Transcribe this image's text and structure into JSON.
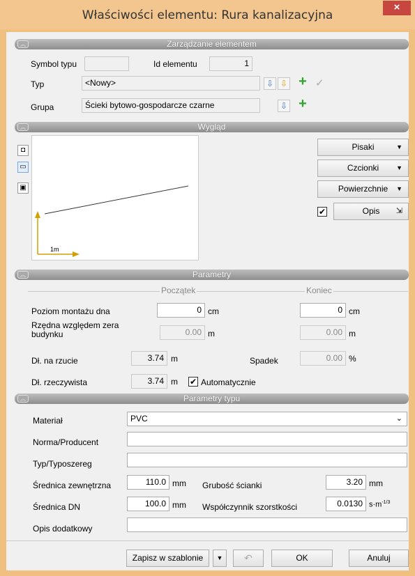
{
  "window": {
    "title": "Właściwości elementu: Rura kanalizacyjna",
    "close": "×"
  },
  "sections": {
    "management": "Zarządzanie elementem",
    "appearance": "Wygląd",
    "parameters": "Parametry",
    "type_parameters": "Parametry typu"
  },
  "management": {
    "symbol_label": "Symbol typu",
    "symbol_value": "",
    "id_label": "Id elementu",
    "id_value": "1",
    "type_label": "Typ",
    "type_value": "<Nowy>",
    "group_label": "Grupa",
    "group_value": "Ścieki bytowo-gospodarcze czarne"
  },
  "appearance": {
    "preview_scale": "1m",
    "buttons": [
      "Pisaki",
      "Czcionki",
      "Powierzchnie"
    ],
    "opis_label": "Opis",
    "opis_checked": true
  },
  "parameters": {
    "start_header": "Początek",
    "end_header": "Koniec",
    "mount_label": "Poziom montażu dna",
    "mount_start": "0",
    "mount_end": "0",
    "unit_cm": "cm",
    "ordinate_label": "Rzędna względem zera budynku",
    "ordinate_start": "0.00",
    "ordinate_end": "0.00",
    "unit_m": "m",
    "projection_label": "Dł. na rzucie",
    "projection_value": "3.74",
    "slope_label": "Spadek",
    "slope_value": "0.00",
    "unit_pct": "%",
    "real_label": "Dł. rzeczywista",
    "real_value": "3.74",
    "auto_label": "Automatycznie",
    "auto_checked": true
  },
  "type_params": {
    "material_label": "Materiał",
    "material_value": "PVC",
    "norm_label": "Norma/Producent",
    "norm_value": "",
    "series_label": "Typ/Typoszereg",
    "series_value": "",
    "outer_label": "Średnica zewnętrzna",
    "outer_value": "110.0",
    "unit_mm": "mm",
    "wall_label": "Grubość ścianki",
    "wall_value": "3.20",
    "dn_label": "Średnica DN",
    "dn_value": "100.0",
    "rough_label": "Współczynnik szorstkości",
    "rough_value": "0.0130",
    "rough_unit": "s·m",
    "rough_exp": "-1/3",
    "extra_label": "Opis dodatkowy",
    "extra_value": ""
  },
  "footer": {
    "save_template": "Zapisz w szablonie",
    "ok": "OK",
    "cancel": "Anuluj"
  }
}
